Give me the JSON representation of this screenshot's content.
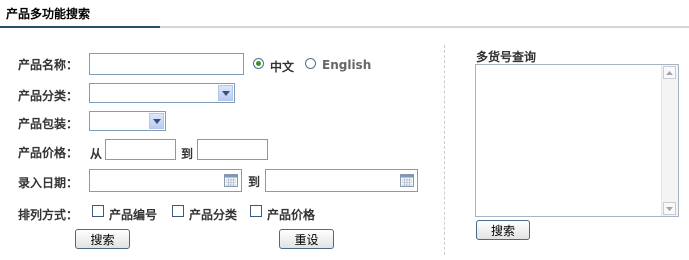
{
  "header": {
    "title": "产品多功能搜索"
  },
  "form": {
    "name_label": "产品名称：",
    "lang_chinese": "中文",
    "lang_english": "English",
    "category_label": "产品分类：",
    "package_label": "产品包装：",
    "price_label": "产品价格：",
    "price_from": "从",
    "price_to": "到",
    "date_label": "录入日期：",
    "date_to": "到",
    "sort_label": "排列方式：",
    "sort_options": [
      "产品编号",
      "产品分类",
      "产品价格"
    ],
    "search_button": "搜索",
    "reset_button": "重设"
  },
  "multi": {
    "title": "多货号查询",
    "search_button": "搜索"
  },
  "icons": {
    "radio_selected": "radio-selected-icon",
    "dropdown": "chevron-down-icon",
    "calendar": "calendar-icon"
  },
  "colors": {
    "accent": "#274f6e",
    "border": "#7f9db9"
  }
}
